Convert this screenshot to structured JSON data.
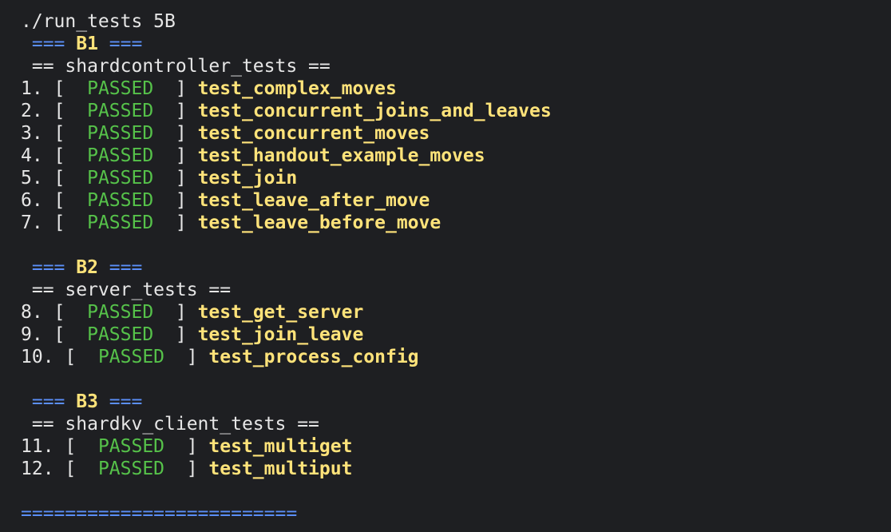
{
  "command": "./run_tests 5B",
  "divider": "=========================",
  "groups": [
    {
      "id": "B1",
      "suite": "shardcontroller_tests",
      "tests": [
        {
          "num": "1.",
          "status": "PASSED",
          "name": "test_complex_moves"
        },
        {
          "num": "2.",
          "status": "PASSED",
          "name": "test_concurrent_joins_and_leaves"
        },
        {
          "num": "3.",
          "status": "PASSED",
          "name": "test_concurrent_moves"
        },
        {
          "num": "4.",
          "status": "PASSED",
          "name": "test_handout_example_moves"
        },
        {
          "num": "5.",
          "status": "PASSED",
          "name": "test_join"
        },
        {
          "num": "6.",
          "status": "PASSED",
          "name": "test_leave_after_move"
        },
        {
          "num": "7.",
          "status": "PASSED",
          "name": "test_leave_before_move"
        }
      ]
    },
    {
      "id": "B2",
      "suite": "server_tests",
      "tests": [
        {
          "num": "8.",
          "status": "PASSED",
          "name": "test_get_server"
        },
        {
          "num": "9.",
          "status": "PASSED",
          "name": "test_join_leave"
        },
        {
          "num": "10.",
          "status": "PASSED",
          "name": "test_process_config"
        }
      ]
    },
    {
      "id": "B3",
      "suite": "shardkv_client_tests",
      "tests": [
        {
          "num": "11.",
          "status": "PASSED",
          "name": "test_multiget"
        },
        {
          "num": "12.",
          "status": "PASSED",
          "name": "test_multiput"
        }
      ]
    }
  ],
  "colors": {
    "background": "#1e1f22",
    "text": "#e6e6e6",
    "header_equals": "#5b8ff9",
    "group_id": "#ffe37a",
    "passed": "#56c24a",
    "test_name": "#ffe37a"
  }
}
